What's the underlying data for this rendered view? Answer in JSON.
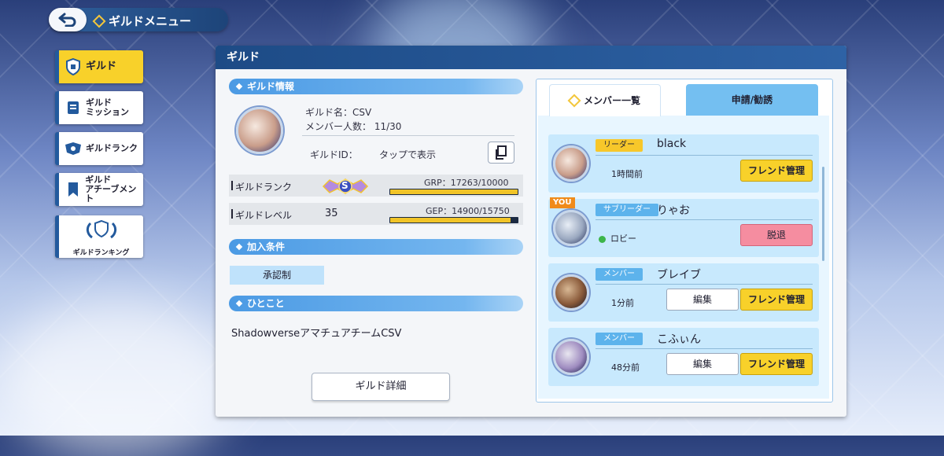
{
  "header": {
    "title": "ギルドメニュー"
  },
  "sidebar": {
    "items": [
      {
        "label": "ギルド"
      },
      {
        "label": "ギルド\nミッション"
      },
      {
        "label": "ギルドランク"
      },
      {
        "label": "ギルド\nアチーブメント"
      },
      {
        "label": "ギルドランキング"
      }
    ]
  },
  "panel": {
    "title": "ギルド",
    "info_section": "ギルド情報",
    "guild_name": "ギルド名：CSV",
    "member_count": "メンバー人数： 11/30",
    "guild_id_label": "ギルドID：",
    "guild_id_value": "タップで表示",
    "rank_label": "ギルドランク",
    "rank_badge": "S",
    "grp_text": "GRP：17263/10000",
    "grp_fill": 1.0,
    "level_label": "ギルドレベル",
    "level_value": "35",
    "gep_text": "GEP：14900/15750",
    "gep_fill": 0.946,
    "join_section": "加入条件",
    "join_condition": "承認制",
    "comment_section": "ひとこと",
    "comment": "ShadowverseアマチュアチームCSV",
    "detail_button": "ギルド詳細"
  },
  "members": {
    "tab_members": "メンバー一覧",
    "tab_requests": "申請/勧誘",
    "list": [
      {
        "role": "リーダー",
        "name": "black",
        "status": "1時間前",
        "friend_btn": "フレンド管理"
      },
      {
        "you": "YOU",
        "role": "サブリーダー",
        "name": "りゃお",
        "status": "ロビー",
        "leave_btn": "脱退"
      },
      {
        "role": "メンバー",
        "name": "ブレイブ",
        "status": "1分前",
        "edit_btn": "編集",
        "friend_btn": "フレンド管理"
      },
      {
        "role": "メンバー",
        "name": "こふぃん",
        "status": "48分前",
        "edit_btn": "編集",
        "friend_btn": "フレンド管理"
      }
    ]
  },
  "colors": {
    "accent_blue": "#2e62a5",
    "highlight_yellow": "#f8d12a",
    "leave_pink": "#f58da0",
    "online_green": "#3cb54a"
  }
}
